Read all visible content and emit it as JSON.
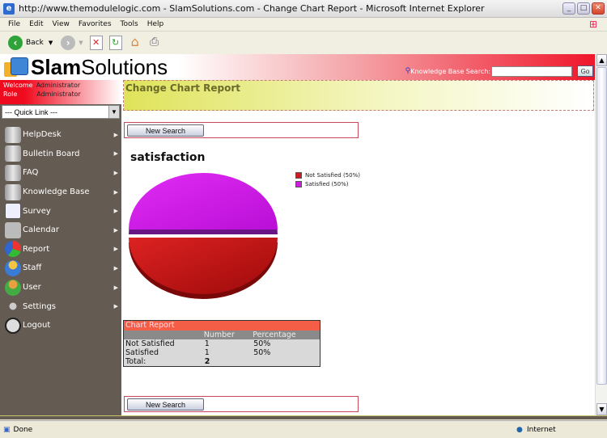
{
  "browser": {
    "title": "http://www.themodulelogic.com - SlamSolutions.com - Change Chart Report - Microsoft Internet Explorer",
    "menu": [
      "File",
      "Edit",
      "View",
      "Favorites",
      "Tools",
      "Help"
    ],
    "back_label": "Back",
    "status_text": "Done",
    "zone_text": "Internet"
  },
  "header": {
    "logo_bold": "Slam",
    "logo_light": "Solutions",
    "kb_search_label": "Knowledge Base Search:",
    "kb_search_value": "",
    "go_label": "Go"
  },
  "sidebar": {
    "welcome_label": "Welcome",
    "welcome_value": "Administrator",
    "role_label": "Role",
    "role_value": "Administrator",
    "quick_link": "--- Quick Link ---",
    "items": [
      {
        "label": "HelpDesk",
        "icon": "server-icon",
        "submenu": true
      },
      {
        "label": "Bulletin Board",
        "icon": "server-icon",
        "submenu": true
      },
      {
        "label": "FAQ",
        "icon": "server-icon",
        "submenu": true
      },
      {
        "label": "Knowledge Base",
        "icon": "server-icon",
        "submenu": true
      },
      {
        "label": "Survey",
        "icon": "survey-icon",
        "submenu": true
      },
      {
        "label": "Calendar",
        "icon": "calendar-icon",
        "submenu": true
      },
      {
        "label": "Report",
        "icon": "report-icon",
        "submenu": true
      },
      {
        "label": "Staff",
        "icon": "staff-icon",
        "submenu": true
      },
      {
        "label": "User",
        "icon": "user-icon",
        "submenu": true
      },
      {
        "label": "Settings",
        "icon": "settings-icon",
        "submenu": true
      },
      {
        "label": "Logout",
        "icon": "logout-icon",
        "submenu": false
      }
    ]
  },
  "main": {
    "page_title": "Change Chart Report",
    "new_search_label": "New Search",
    "chart_title": "satisfaction",
    "legend": [
      {
        "label": "Not Satisfied (50%)",
        "color": "#d01a20"
      },
      {
        "label": "Satisfied (50%)",
        "color": "#d21be0"
      }
    ],
    "report": {
      "caption": "Chart Report",
      "headers": [
        "",
        "Number",
        "Percentage"
      ],
      "rows": [
        [
          "Not Satisfied",
          "1",
          "50%"
        ],
        [
          "Satisfied",
          "1",
          "50%"
        ]
      ],
      "total_label": "Total:",
      "total_value": "2"
    }
  },
  "chart_data": {
    "type": "pie",
    "title": "satisfaction",
    "categories": [
      "Not Satisfied",
      "Satisfied"
    ],
    "values": [
      1,
      1
    ],
    "percentages": [
      50,
      50
    ],
    "colors": [
      "#d01a20",
      "#d21be0"
    ],
    "legend": "right"
  }
}
